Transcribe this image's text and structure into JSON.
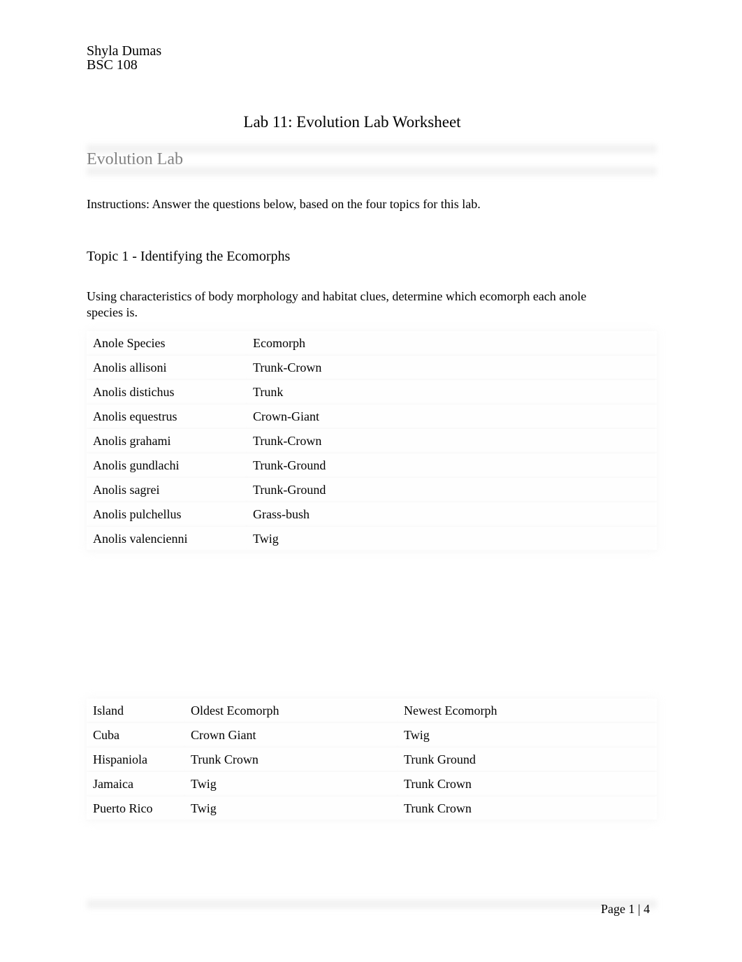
{
  "header": {
    "author": "Shyla Dumas",
    "course": "BSC 108"
  },
  "document": {
    "title": "Lab 11: Evolution Lab Worksheet",
    "section_title": "Evolution Lab",
    "instructions": "Instructions: Answer the questions below, based on the four topics for this lab.",
    "topic1": {
      "heading": "Topic 1 - Identifying the Ecomorphs",
      "prompt": "Using characteristics of body morphology and habitat clues, determine which ecomorph each anole species is."
    }
  },
  "ecomorph_table": {
    "headers": [
      "Anole Species",
      "Ecomorph"
    ],
    "rows": [
      [
        "Anolis allisoni",
        "Trunk-Crown"
      ],
      [
        "Anolis distichus",
        "Trunk"
      ],
      [
        "Anolis equestrus",
        "Crown-Giant"
      ],
      [
        "Anolis grahami",
        "Trunk-Crown"
      ],
      [
        "Anolis gundlachi",
        "Trunk-Ground"
      ],
      [
        "Anolis sagrei",
        "Trunk-Ground"
      ],
      [
        "Anolis pulchellus",
        "Grass-bush"
      ],
      [
        "Anolis valencienni",
        "Twig"
      ]
    ]
  },
  "island_table": {
    "headers": [
      "Island",
      "Oldest Ecomorph",
      "Newest Ecomorph"
    ],
    "rows": [
      [
        "Cuba",
        "Crown Giant",
        "Twig"
      ],
      [
        "Hispaniola",
        "Trunk Crown",
        "Trunk Ground"
      ],
      [
        "Jamaica",
        "Twig",
        "Trunk Crown"
      ],
      [
        "Puerto Rico",
        "Twig",
        "Trunk Crown"
      ]
    ]
  },
  "footer": {
    "page_label": "Page 1 |  4"
  }
}
